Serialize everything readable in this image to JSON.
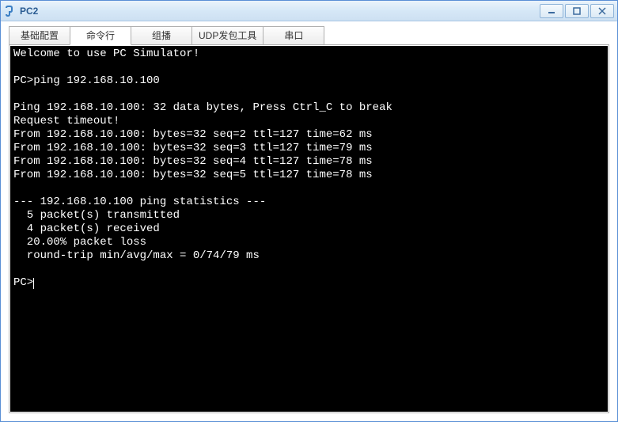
{
  "window": {
    "title": "PC2"
  },
  "tabs": [
    {
      "label": "基础配置",
      "active": false
    },
    {
      "label": "命令行",
      "active": true
    },
    {
      "label": "组播",
      "active": false
    },
    {
      "label": "UDP发包工具",
      "active": false
    },
    {
      "label": "串口",
      "active": false
    }
  ],
  "terminal": {
    "lines": [
      "Welcome to use PC Simulator!",
      "",
      "PC>ping 192.168.10.100",
      "",
      "Ping 192.168.10.100: 32 data bytes, Press Ctrl_C to break",
      "Request timeout!",
      "From 192.168.10.100: bytes=32 seq=2 ttl=127 time=62 ms",
      "From 192.168.10.100: bytes=32 seq=3 ttl=127 time=79 ms",
      "From 192.168.10.100: bytes=32 seq=4 ttl=127 time=78 ms",
      "From 192.168.10.100: bytes=32 seq=5 ttl=127 time=78 ms",
      "",
      "--- 192.168.10.100 ping statistics ---",
      "  5 packet(s) transmitted",
      "  4 packet(s) received",
      "  20.00% packet loss",
      "  round-trip min/avg/max = 0/74/79 ms",
      ""
    ],
    "prompt": "PC>"
  }
}
